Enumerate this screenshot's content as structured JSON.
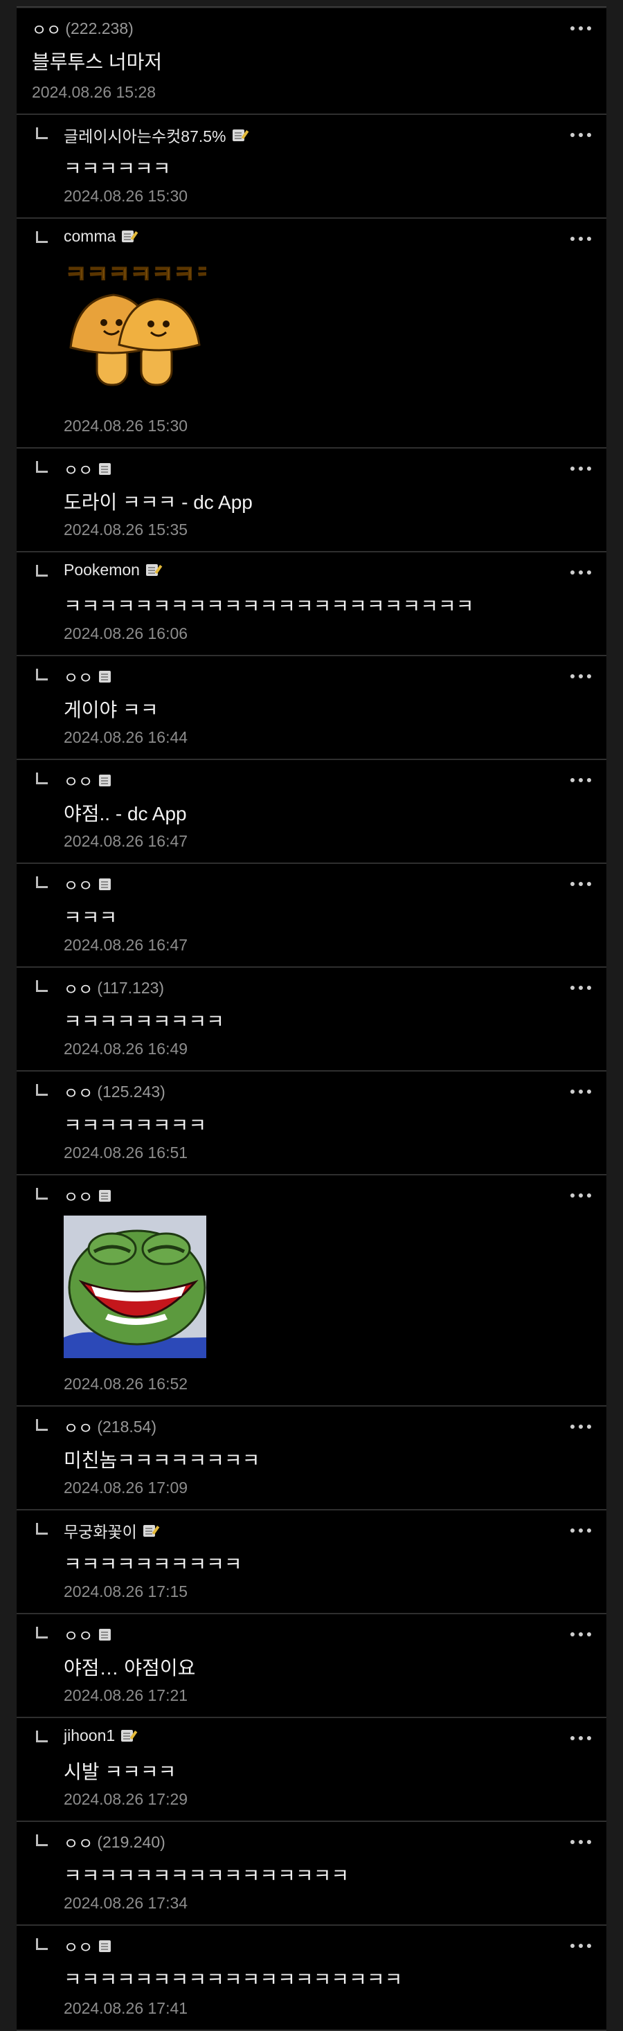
{
  "icons": {
    "more": "more-vertical-dots-icon",
    "reply_indent": "reply-indent-icon",
    "badge": "fixed-nick-badge-icon"
  },
  "colors": {
    "background": "#000000",
    "divider": "#2f2f2f",
    "date_text": "#8d8d8d",
    "ip_text": "#9a9a9a"
  },
  "comments": [
    {
      "author": "ㅇㅇ",
      "ip": "(222.238)",
      "badge": "",
      "text": "블루투스 너마저",
      "date": "2024.08.26 15:28",
      "reply": false
    },
    {
      "author": "글레이시아는수컷87.5%",
      "ip": "",
      "badge": "pen",
      "text": "ㅋㅋㅋㅋㅋㅋ",
      "date": "2024.08.26 15:30",
      "reply": true
    },
    {
      "author": "comma",
      "ip": "",
      "badge": "pen",
      "text": "",
      "date": "2024.08.26 15:30",
      "reply": true,
      "media": "mushroom-sticker",
      "sticker_text": "ㅋㅋㅋㅋㅋㅋㅋ"
    },
    {
      "author": "ㅇㅇ",
      "ip": "",
      "badge": "plain",
      "text": "도라이 ㅋㅋㅋ - dc App",
      "date": "2024.08.26 15:35",
      "reply": true
    },
    {
      "author": "Pookemon",
      "ip": "",
      "badge": "pen",
      "text": "ㅋㅋㅋㅋㅋㅋㅋㅋㅋㅋㅋㅋㅋㅋㅋㅋㅋㅋㅋㅋㅋㅋㅋ",
      "date": "2024.08.26 16:06",
      "reply": true
    },
    {
      "author": "ㅇㅇ",
      "ip": "",
      "badge": "plain",
      "text": "게이야 ㅋㅋ",
      "date": "2024.08.26 16:44",
      "reply": true
    },
    {
      "author": "ㅇㅇ",
      "ip": "",
      "badge": "plain",
      "text": "야점.. - dc App",
      "date": "2024.08.26 16:47",
      "reply": true
    },
    {
      "author": "ㅇㅇ",
      "ip": "",
      "badge": "plain",
      "text": "ㅋㅋㅋ",
      "date": "2024.08.26 16:47",
      "reply": true
    },
    {
      "author": "ㅇㅇ",
      "ip": "(117.123)",
      "badge": "",
      "text": "ㅋㅋㅋㅋㅋㅋㅋㅋㅋ",
      "date": "2024.08.26 16:49",
      "reply": true
    },
    {
      "author": "ㅇㅇ",
      "ip": "(125.243)",
      "badge": "",
      "text": "ㅋㅋㅋㅋㅋㅋㅋㅋ",
      "date": "2024.08.26 16:51",
      "reply": true
    },
    {
      "author": "ㅇㅇ",
      "ip": "",
      "badge": "plain",
      "text": "",
      "date": "2024.08.26 16:52",
      "reply": true,
      "media": "pepe-laughing-image"
    },
    {
      "author": "ㅇㅇ",
      "ip": "(218.54)",
      "badge": "",
      "text": "미친놈ㅋㅋㅋㅋㅋㅋㅋㅋ",
      "date": "2024.08.26 17:09",
      "reply": true
    },
    {
      "author": "무궁화꽃이",
      "ip": "",
      "badge": "pen",
      "text": "ㅋㅋㅋㅋㅋㅋㅋㅋㅋㅋ",
      "date": "2024.08.26 17:15",
      "reply": true
    },
    {
      "author": "ㅇㅇ",
      "ip": "",
      "badge": "plain",
      "text": "야점… 야점이요",
      "date": "2024.08.26 17:21",
      "reply": true
    },
    {
      "author": "jihoon1",
      "ip": "",
      "badge": "pen",
      "text": "시발 ㅋㅋㅋㅋ",
      "date": "2024.08.26 17:29",
      "reply": true
    },
    {
      "author": "ㅇㅇ",
      "ip": "(219.240)",
      "badge": "",
      "text": "ㅋㅋㅋㅋㅋㅋㅋㅋㅋㅋㅋㅋㅋㅋㅋㅋ",
      "date": "2024.08.26 17:34",
      "reply": true
    },
    {
      "author": "ㅇㅇ",
      "ip": "",
      "badge": "plain",
      "text": "ㅋㅋㅋㅋㅋㅋㅋㅋㅋㅋㅋㅋㅋㅋㅋㅋㅋㅋㅋ",
      "date": "2024.08.26 17:41",
      "reply": true
    }
  ]
}
